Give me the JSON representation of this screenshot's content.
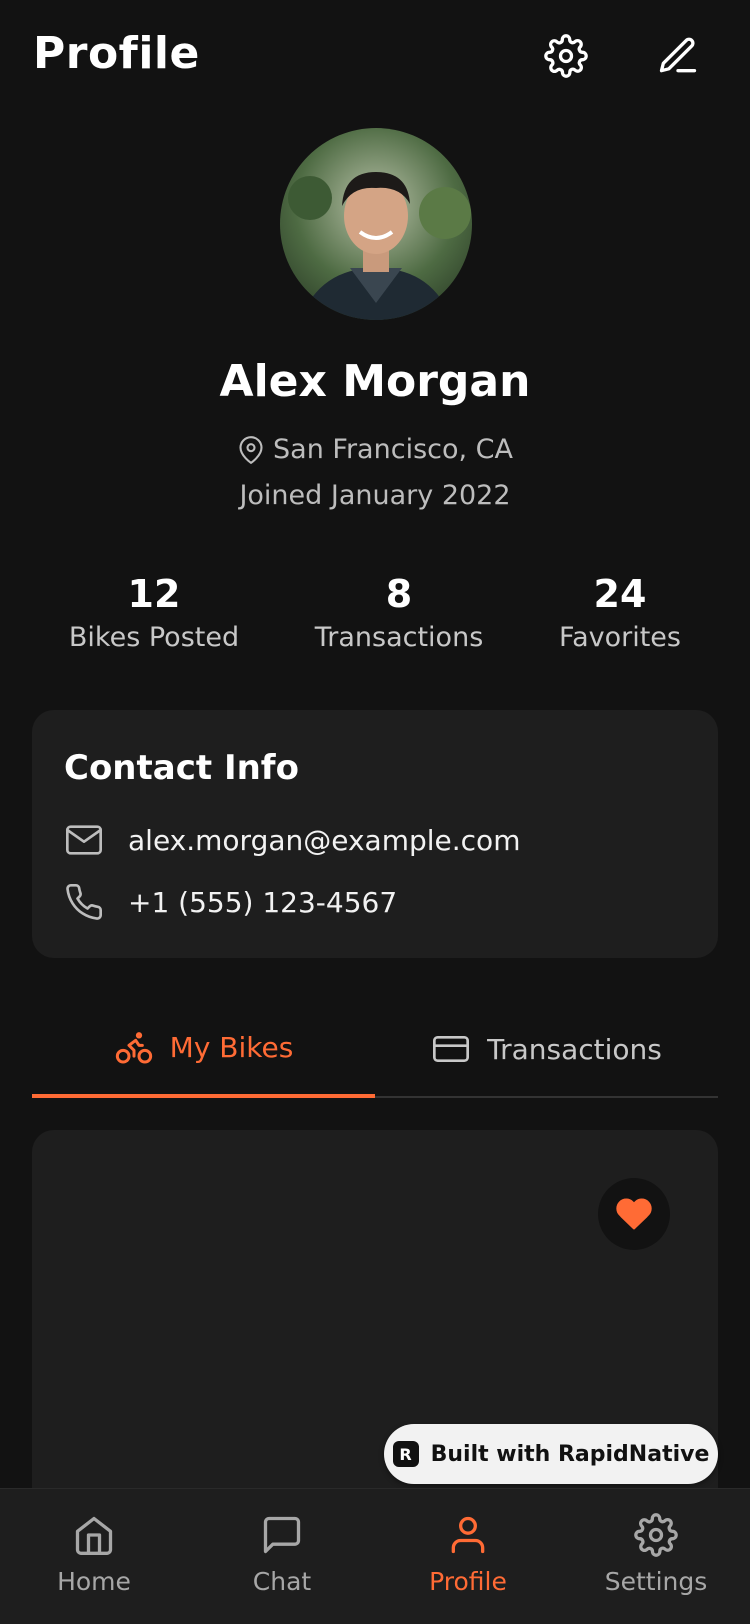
{
  "header": {
    "title": "Profile",
    "settings_icon": "gear-icon",
    "edit_icon": "pencil-icon"
  },
  "profile": {
    "avatar_alt": "Profile photo",
    "name": "Alex Morgan",
    "location": "San Francisco, CA",
    "joined": "Joined January 2022"
  },
  "stats": [
    {
      "value": "12",
      "label": "Bikes Posted"
    },
    {
      "value": "8",
      "label": "Transactions"
    },
    {
      "value": "24",
      "label": "Favorites"
    }
  ],
  "contact": {
    "title": "Contact Info",
    "email": "alex.morgan@example.com",
    "phone": "+1 (555) 123-4567"
  },
  "tabs": [
    {
      "label": "My Bikes",
      "icon": "bike-icon",
      "active": true
    },
    {
      "label": "Transactions",
      "icon": "card-icon",
      "active": false
    }
  ],
  "badge": {
    "label": "Built with RapidNative"
  },
  "nav": [
    {
      "label": "Home",
      "icon": "home-icon"
    },
    {
      "label": "Chat",
      "icon": "chat-icon"
    },
    {
      "label": "Profile",
      "icon": "user-icon"
    },
    {
      "label": "Settings",
      "icon": "gear-icon"
    }
  ],
  "colors": {
    "accent": "#ff6b35",
    "background": "#121212",
    "card": "#1e1e1e"
  }
}
